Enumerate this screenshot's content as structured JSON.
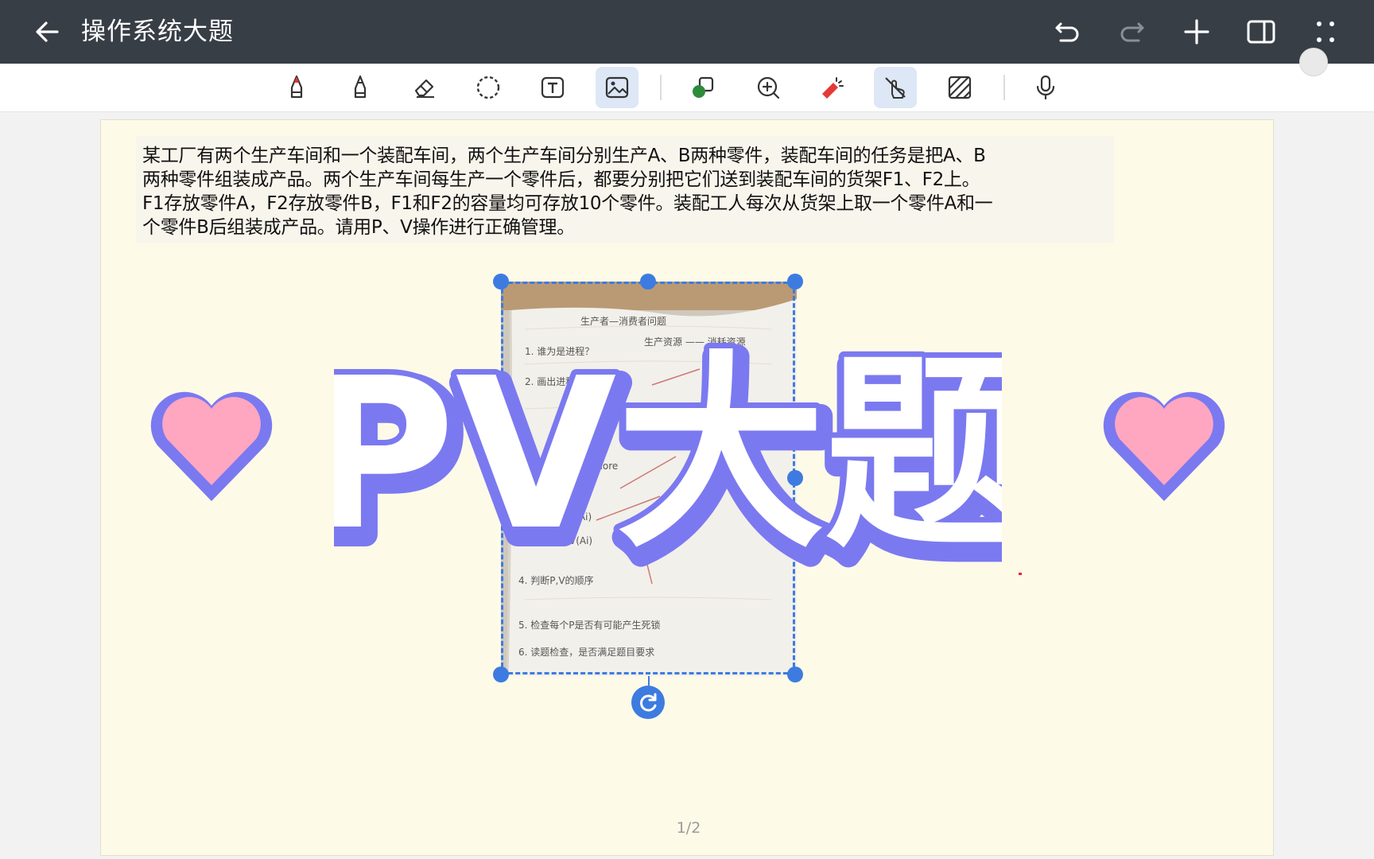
{
  "titlebar": {
    "title": "操作系统大题"
  },
  "question": {
    "lines": [
      "某工厂有两个生产车间和一个装配车间，两个生产车间分别生产A、B两种零件，装配车间的任务是把A、B",
      "两种零件组装成产品。两个生产车间每生产一个零件后，都要分别把它们送到装配车间的货架F1、F2上。",
      "F1存放零件A，F2存放零件B，F1和F2的容量均可存放10个零件。装配工人每次从货架上取一个零件A和一",
      "个零件B后组装成产品。请用P、V操作进行正确管理。"
    ]
  },
  "overlay": {
    "text": "PV大题"
  },
  "photo_notes": {
    "lines": [
      "生产者—消费者问题",
      "生产资源 —— 消耗资源",
      "1. 谁为是进程？",
      "2. 画出进程图",
      "semaphore",
      "P(Ai)",
      "V(Ai)",
      "4. 判断P,V的顺序",
      "5. 检查每个P是否有可能产生死锁",
      "6. 读题检查，是否满足题目要求"
    ]
  },
  "pagination": {
    "label": "1/2"
  },
  "colors": {
    "titlebar": "#383e46",
    "page": "#fefae8",
    "selection": "#3d7be0",
    "overlay_fill": "#ffffff",
    "overlay_outline": "#7b79f0",
    "heart_fill": "#ffa6c1"
  }
}
